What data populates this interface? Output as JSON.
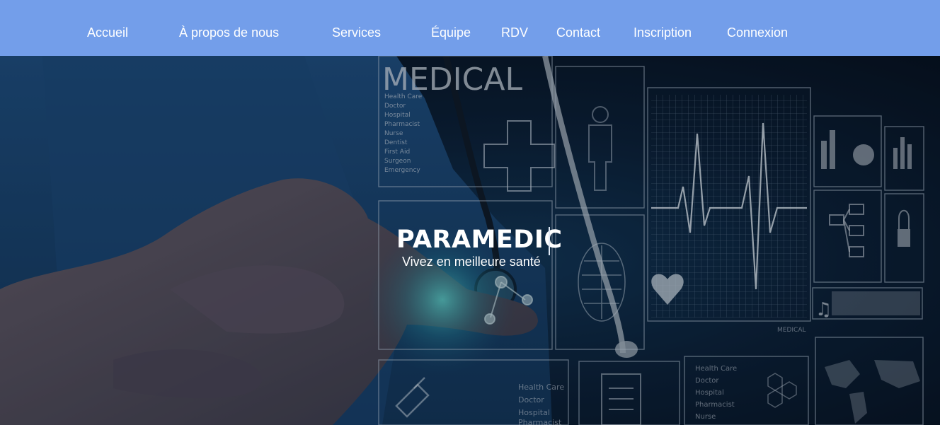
{
  "nav": {
    "items": [
      {
        "label": "Accueil"
      },
      {
        "label": "À propos de nous"
      },
      {
        "label": "Services"
      },
      {
        "label": "Équipe"
      },
      {
        "label": "RDV"
      },
      {
        "label": "Contact"
      },
      {
        "label": "Inscription"
      },
      {
        "label": "Connexion"
      }
    ]
  },
  "hero": {
    "title": "PARAMEDIC",
    "subtitle": "Vivez en meilleure santé",
    "image_text": {
      "heading": "MEDICAL",
      "list_top": [
        "Health Care",
        "Doctor",
        "Hospital",
        "Pharmacist",
        "Nurse",
        "Dentist",
        "First Aid",
        "Surgeon",
        "Emergency"
      ],
      "list_bottom_left": [
        "Health Care",
        "Doctor",
        "Hospital",
        "Pharmacist"
      ],
      "list_bottom_right": [
        "Health Care",
        "Doctor",
        "Hospital",
        "Pharmacist",
        "Nurse"
      ],
      "ecg_label": "MEDICAL"
    }
  },
  "colors": {
    "navbar": "#739eea",
    "text": "#ffffff",
    "hero_bg": "#0b1f35"
  }
}
